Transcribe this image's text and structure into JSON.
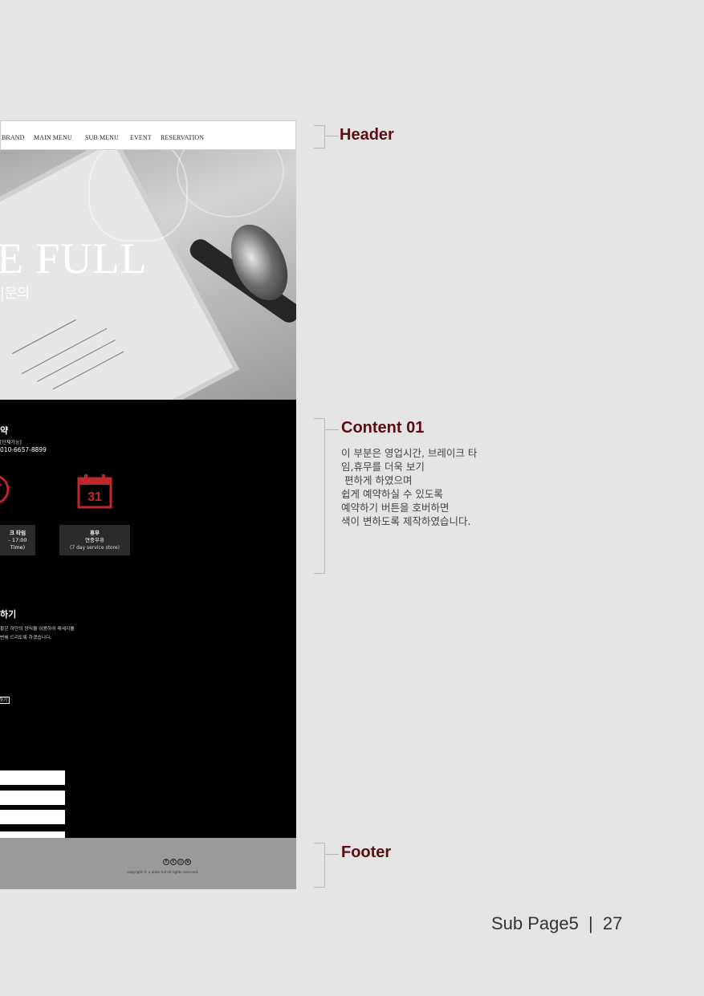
{
  "nav": {
    "items": [
      "BRAND",
      "MAIN MENU",
      "SUB MENU",
      "EVENT",
      "RESERVATION"
    ]
  },
  "hero": {
    "title": "E FULL",
    "subtitle": "|문의"
  },
  "reservation": {
    "title": "약",
    "note": "[단체가능]",
    "phone": "010-6657-8899",
    "calendar_day": "31",
    "break_box": {
      "title": "크 타임",
      "line1": "- 17:00",
      "line2": "Time)"
    },
    "holiday_box": {
      "title": "휴무",
      "line1": "연중무휴",
      "line2": "(7 day service store)"
    },
    "button_label": "하기"
  },
  "contact": {
    "title": "하기",
    "desc_line1": "황은 하단의 양식을 이용하여 메세지를",
    "desc_line2": "변해 드리도록 하겠습니다.",
    "submit_label": "하기"
  },
  "footer": {
    "sns_icons": [
      "facebook-icon",
      "twitter-icon",
      "instagram-icon",
      "blog-icon"
    ],
    "copyright": "copyright © a plate full all rights reserved."
  },
  "annotations": {
    "header": "Header",
    "content01": "Content 01",
    "content01_desc": "이 부분은 영업시간, 브레이크 타\n임,휴무를 더욱 보기\n 편하게 하였으며\n쉽게 예약하실 수 있도록\n예약하기 버튼을 호버하면\n색이 변하도록 제작하였습니다.",
    "footer": "Footer"
  },
  "page": {
    "label": "Sub Page5",
    "separator": "|",
    "number": "27"
  },
  "colors": {
    "accent": "#5c0d12",
    "icon_red": "#c0272d",
    "background": "#e4e4e4"
  }
}
